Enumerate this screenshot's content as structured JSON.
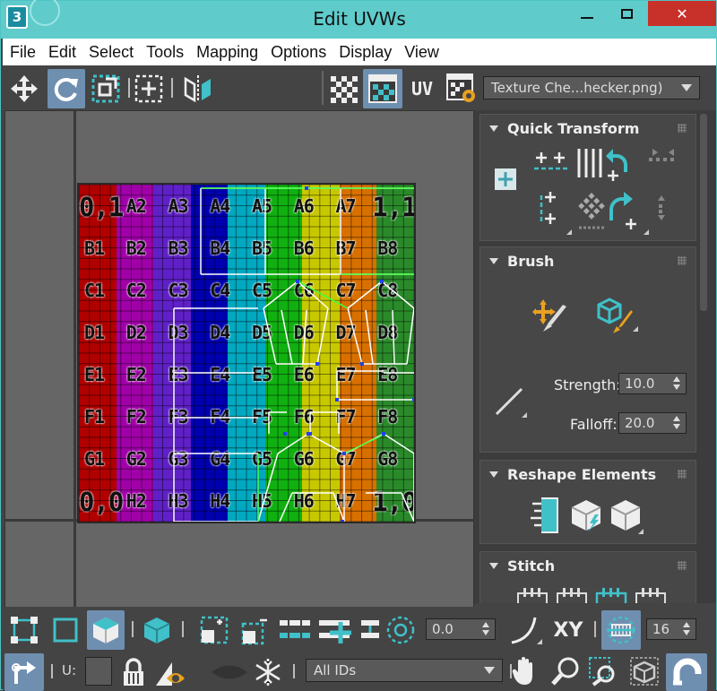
{
  "window": {
    "title": "Edit UVWs",
    "app_icon_text": "3",
    "close_glyph": "✕"
  },
  "menu": [
    "File",
    "Edit",
    "Select",
    "Tools",
    "Mapping",
    "Options",
    "Display",
    "View"
  ],
  "toolbar": {
    "uv_label": "UV",
    "texture_dropdown": "Texture Che...hecker.png)",
    "icons": [
      "move-icon",
      "rotate-icon",
      "freeform-scale-icon",
      "freeform-mode-icon",
      "mirror-icon",
      "show-map-checker-icon",
      "show-map-icon",
      "uv-axis-icon",
      "map-settings-icon"
    ]
  },
  "checker": {
    "columns": [
      "#b00000",
      "#a000a8",
      "#6020c8",
      "#0000b0",
      "#00a8c0",
      "#10b010",
      "#c8c800",
      "#d87000",
      "#2a8a2a"
    ],
    "rows": [
      [
        "0,1",
        "A2",
        "A3",
        "A4",
        "A5",
        "A6",
        "A7",
        "1,1"
      ],
      [
        "B1",
        "B2",
        "B3",
        "B4",
        "B5",
        "B6",
        "B7",
        "B8"
      ],
      [
        "C1",
        "C2",
        "C3",
        "C4",
        "C5",
        "C6",
        "C7",
        "C8"
      ],
      [
        "D1",
        "D2",
        "D3",
        "D4",
        "D5",
        "D6",
        "D7",
        "D8"
      ],
      [
        "E1",
        "E2",
        "E3",
        "E4",
        "E5",
        "E6",
        "E7",
        "E8"
      ],
      [
        "F1",
        "F2",
        "F3",
        "F4",
        "F5",
        "F6",
        "F7",
        "F8"
      ],
      [
        "G1",
        "G2",
        "G3",
        "G4",
        "G5",
        "G6",
        "G7",
        "G8"
      ],
      [
        "0,0",
        "H2",
        "H3",
        "H4",
        "H5",
        "H6",
        "H7",
        "1,0"
      ]
    ]
  },
  "panel": {
    "quick_transform": {
      "title": "Quick Transform"
    },
    "brush": {
      "title": "Brush",
      "strength_label": "Strength:",
      "strength_value": "10.0",
      "falloff_label": "Falloff:",
      "falloff_value": "20.0"
    },
    "reshape": {
      "title": "Reshape Elements"
    },
    "stitch": {
      "title": "Stitch"
    }
  },
  "bottom": {
    "angle_value": "0.0",
    "xy_label": "XY",
    "grid_value": "16",
    "u_label": "U:",
    "ids_dropdown": "All IDs"
  },
  "colors": {
    "accent": "#40c0c8",
    "titlebar": "#5fcbcb",
    "close": "#c8302a",
    "active_button": "#6f8fb0"
  }
}
